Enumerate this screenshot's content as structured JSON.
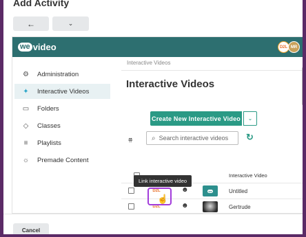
{
  "dialog": {
    "title": "Add Activity",
    "back_icon": "arrow-left-icon",
    "dropdown_icon": "chevron-down-icon",
    "cancel_label": "Cancel"
  },
  "topbar": {
    "logo_we": "we",
    "logo_rest": "video",
    "d2l_badge": "D2L",
    "avatar_initials": "MR"
  },
  "sidebar": {
    "items": [
      {
        "label": "Administration",
        "icon": "gear-icon"
      },
      {
        "label": "Interactive Videos",
        "icon": "interactive-icon",
        "active": true
      },
      {
        "label": "Folders",
        "icon": "folder-icon"
      },
      {
        "label": "Classes",
        "icon": "graduation-cap-icon"
      },
      {
        "label": "Playlists",
        "icon": "playlist-icon"
      },
      {
        "label": "Premade Content",
        "icon": "lightbulb-icon"
      }
    ]
  },
  "main": {
    "breadcrumb": "Interactive Videos",
    "title": "Interactive Videos",
    "create_button": "Create New Interactive Video",
    "search_placeholder": "Search interactive videos",
    "column_header": "Interactive Video",
    "tooltip": "Link interactive video",
    "rows": [
      {
        "d2l": "D2L",
        "title": "Untitled",
        "thumb_text": "we"
      },
      {
        "d2l": "D2L",
        "title": "Gertrude"
      }
    ]
  },
  "colors": {
    "accent": "#2d6f70",
    "button": "#2a9a85",
    "highlight": "#a23cdb",
    "frame": "#5b2a66"
  }
}
